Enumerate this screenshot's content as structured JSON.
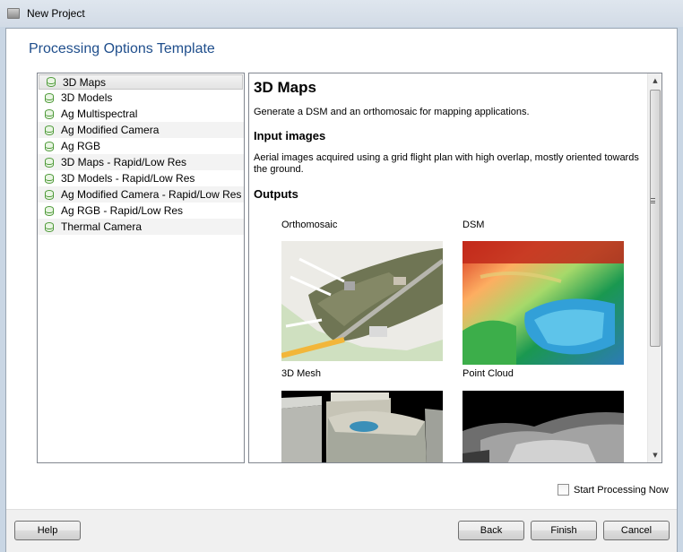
{
  "window": {
    "title": "New Project"
  },
  "page": {
    "heading": "Processing Options Template"
  },
  "templates": [
    {
      "label": "3D Maps",
      "selected": true
    },
    {
      "label": "3D Models"
    },
    {
      "label": "Ag Multispectral"
    },
    {
      "label": "Ag Modified Camera"
    },
    {
      "label": "Ag RGB"
    },
    {
      "label": "3D Maps - Rapid/Low Res"
    },
    {
      "label": "3D Models - Rapid/Low Res"
    },
    {
      "label": "Ag Modified Camera - Rapid/Low Res"
    },
    {
      "label": "Ag RGB - Rapid/Low Res"
    },
    {
      "label": "Thermal Camera"
    }
  ],
  "detail": {
    "title": "3D Maps",
    "description": "Generate a DSM and an orthomosaic for mapping applications.",
    "input_heading": "Input images",
    "input_text": "Aerial images acquired using a grid flight plan with high overlap, mostly oriented towards the ground.",
    "outputs_heading": "Outputs",
    "outputs": [
      {
        "label": "Orthomosaic"
      },
      {
        "label": "DSM"
      },
      {
        "label": "3D Mesh"
      },
      {
        "label": "Point Cloud"
      }
    ]
  },
  "options": {
    "start_processing_label": "Start Processing Now",
    "start_processing_checked": false
  },
  "buttons": {
    "help": "Help",
    "back": "Back",
    "finish": "Finish",
    "cancel": "Cancel"
  },
  "icons": {
    "list_item": "database-icon",
    "window": "app-icon"
  }
}
